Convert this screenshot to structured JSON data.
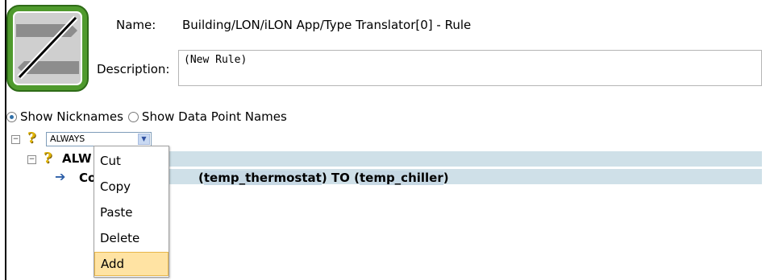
{
  "header": {
    "name_label": "Name:",
    "name_value": "Building/LON/iLON App/Type Translator[0] - Rule",
    "description_label": "Description:",
    "description_value": "(New Rule)"
  },
  "view_options": {
    "show_nicknames": "Show Nicknames",
    "show_data_point_names": "Show Data Point Names",
    "selected": "Show Nicknames"
  },
  "tree": {
    "root_select_value": "ALWAYS",
    "child_label": "ALW",
    "leaf_prefix": "Co",
    "rule_open1": "(",
    "rule_src": "temp_thermostat",
    "rule_mid": ") TO (",
    "rule_dst": "temp_chiller",
    "rule_close": ")"
  },
  "context_menu": {
    "items": [
      "Cut",
      "Copy",
      "Paste",
      "Delete",
      "Add"
    ],
    "highlighted": "Add"
  },
  "colors": {
    "logo_green": "#4f9a2d",
    "row_highlight": "#cfe0e8",
    "menu_hover": "#ffe3a3"
  },
  "icons": [
    "translator-logo",
    "expand-collapse-icon",
    "question-mark-icon",
    "dropdown-arrow-icon",
    "arrow-right-icon"
  ]
}
